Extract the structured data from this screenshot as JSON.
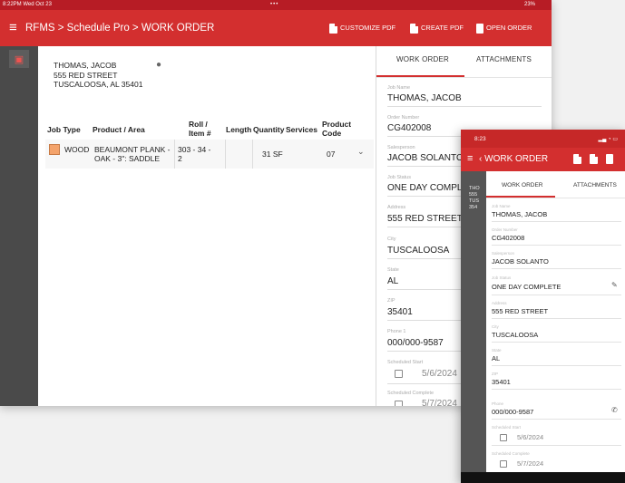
{
  "colors": {
    "primary": "#d32f2f",
    "status_bar": "#b71c25",
    "rail": "#4a4a4a",
    "swatch": "#f4a36b"
  },
  "tablet": {
    "status": {
      "time": "8:22PM  Wed Oct 23",
      "dots": "•••",
      "battery": "23%"
    },
    "app_bar": {
      "menu_icon": "menu-icon",
      "breadcrumb": "RFMS > Schedule Pro > WORK ORDER",
      "actions": {
        "customize": "CUSTOMIZE PDF",
        "create": "CREATE PDF",
        "open": "OPEN ORDER"
      }
    },
    "customer": {
      "name": "THOMAS, JACOB",
      "street": "555 RED STREET",
      "city_state": "TUSCALOOSA, AL 35401"
    },
    "table": {
      "headers": {
        "job_type": "Job Type",
        "product": "Product / Area",
        "roll": "Roll / Item #",
        "length": "Length",
        "quantity": "Quantity",
        "services": "Services",
        "product_code": "Product Code"
      },
      "row": {
        "job_type": "WOOD",
        "product": "BEAUMONT PLANK - OAK - 3\": SADDLE",
        "roll": "303 - 34 - 2",
        "quantity": "31 SF",
        "product_code": "07"
      }
    },
    "panel": {
      "tabs": {
        "work_order": "WORK ORDER",
        "attachments": "ATTACHMENTS"
      },
      "fields": {
        "job_name": {
          "label": "Job Name",
          "value": "THOMAS, JACOB"
        },
        "order_number": {
          "label": "Order Number",
          "value": "CG402008"
        },
        "salesperson": {
          "label": "Salesperson",
          "value": "JACOB SOLANTO"
        },
        "job_status": {
          "label": "Job Status",
          "value": "ONE DAY COMPLETE"
        },
        "address": {
          "label": "Address",
          "value": "555 RED STREET"
        },
        "city": {
          "label": "City",
          "value": "TUSCALOOSA"
        },
        "state": {
          "label": "State",
          "value": "AL"
        },
        "zip": {
          "label": "ZIP",
          "value": "35401"
        },
        "phone": {
          "label": "Phone 1",
          "value": "000/000-9587"
        },
        "scheduled_start": {
          "label": "Scheduled Start",
          "value": "5/6/2024"
        },
        "scheduled_complete": {
          "label": "Scheduled Complete",
          "value": "5/7/2024"
        }
      }
    }
  },
  "phone": {
    "status": {
      "time": "8:23"
    },
    "app_bar": {
      "title": "WORK ORDER"
    },
    "left_peek": {
      "line1": "THO",
      "line2": "555",
      "line3": "TUS",
      "line4": "354"
    },
    "tabs": {
      "work_order": "WORK ORDER",
      "attachments": "ATTACHMENTS"
    },
    "fields": {
      "job_name": {
        "label": "Job Name",
        "value": "THOMAS, JACOB"
      },
      "order_number": {
        "label": "Order Number",
        "value": "CG402008"
      },
      "salesperson": {
        "label": "Salesperson",
        "value": "JACOB SOLANTO"
      },
      "job_status": {
        "label": "Job Status",
        "value": "ONE DAY COMPLETE"
      },
      "address": {
        "label": "Address",
        "value": "555 RED STREET"
      },
      "city": {
        "label": "City",
        "value": "TUSCALOOSA"
      },
      "state": {
        "label": "State",
        "value": "AL"
      },
      "zip": {
        "label": "ZIP",
        "value": "35401"
      },
      "phone": {
        "label": "Phone",
        "value": "000/000-9587"
      },
      "scheduled_start": {
        "label": "Scheduled Start",
        "value": "5/6/2024"
      },
      "scheduled_complete": {
        "label": "Scheduled Complete",
        "value": "5/7/2024"
      }
    }
  }
}
